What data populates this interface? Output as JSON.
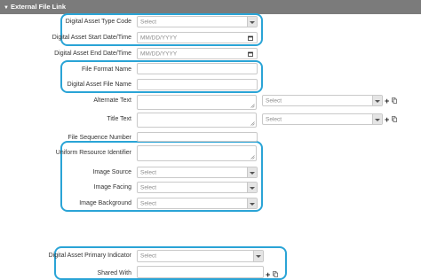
{
  "header": {
    "title": "External File Link"
  },
  "fields": {
    "digital_asset_type_code": {
      "label": "Digital Asset Type Code",
      "value": "Select"
    },
    "start_date": {
      "label": "Digital Asset Start Date/Time",
      "placeholder": "MM/DD/YYYY"
    },
    "end_date": {
      "label": "Digital Asset End Date/Time",
      "placeholder": "MM/DD/YYYY"
    },
    "file_format_name": {
      "label": "File Format Name",
      "value": ""
    },
    "digital_asset_file_name": {
      "label": "Digital Asset File Name",
      "value": ""
    },
    "alternate_text": {
      "label": "Alternate Text",
      "value": "",
      "lang_value": "Select"
    },
    "title_text": {
      "label": "Title Text",
      "value": "",
      "lang_value": "Select"
    },
    "file_sequence_number": {
      "label": "File Sequence Number",
      "value": ""
    },
    "uri": {
      "label": "Uniform Resource Identifier",
      "value": ""
    },
    "image_source": {
      "label": "Image Source",
      "value": "Select"
    },
    "image_facing": {
      "label": "Image Facing",
      "value": "Select"
    },
    "image_background": {
      "label": "Image Background",
      "value": "Select"
    },
    "primary_indicator": {
      "label": "Digital Asset Primary Indicator",
      "value": "Select"
    },
    "shared_with": {
      "label": "Shared With",
      "value": ""
    }
  },
  "icons": {
    "add": "plus-icon",
    "copy": "copy-icon",
    "calendar": "calendar-icon"
  },
  "colors": {
    "header_bg": "#7b7b7b",
    "highlight": "#2aa4d6"
  }
}
